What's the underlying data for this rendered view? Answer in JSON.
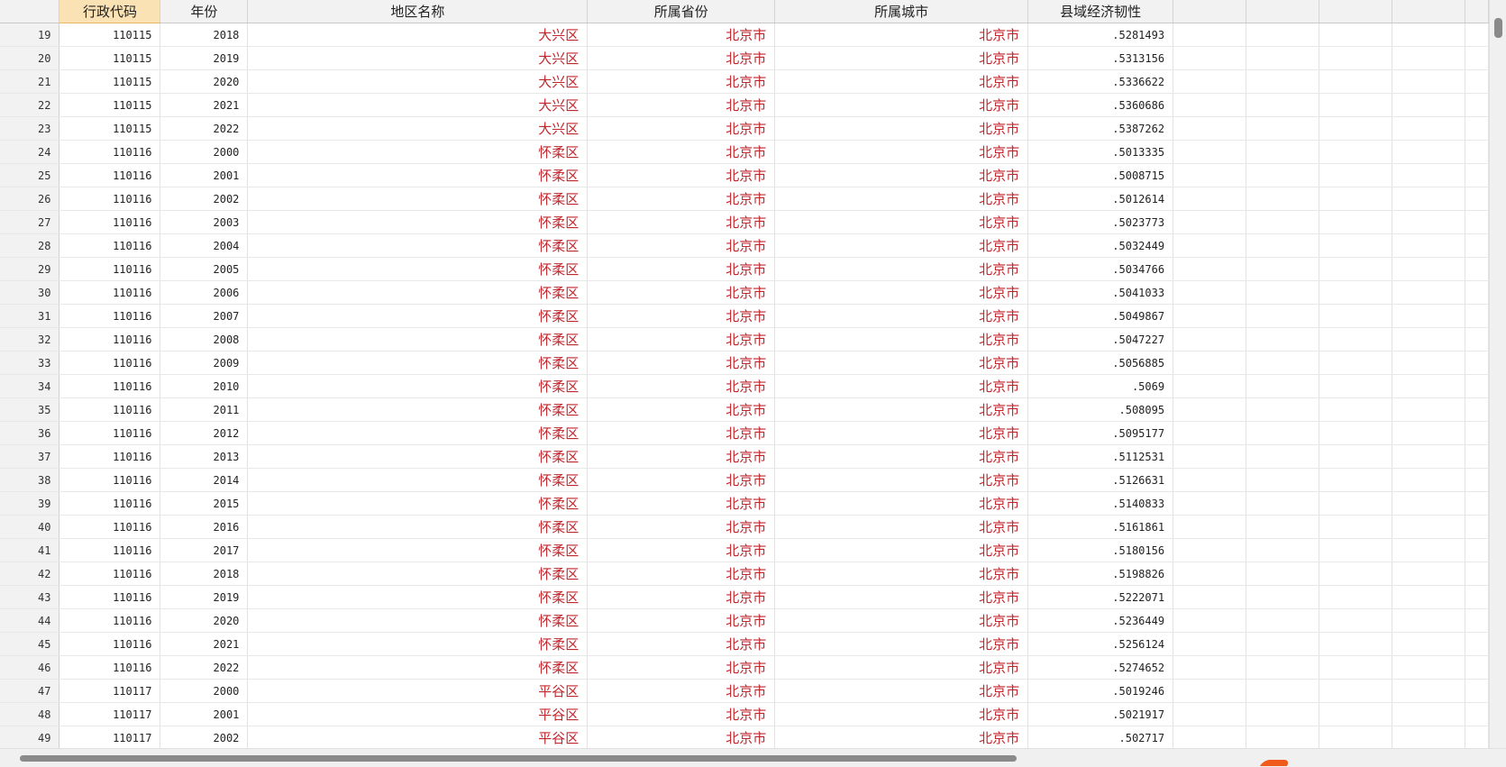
{
  "columns": [
    {
      "label": "行政代码",
      "selected": true
    },
    {
      "label": "年份",
      "selected": false
    },
    {
      "label": "地区名称",
      "selected": false
    },
    {
      "label": "所属省份",
      "selected": false
    },
    {
      "label": "所属城市",
      "selected": false
    },
    {
      "label": "县域经济韧性",
      "selected": false
    }
  ],
  "rows": [
    {
      "n": "19",
      "code": "110115",
      "year": "2018",
      "region": "大兴区",
      "province": "北京市",
      "city": "北京市",
      "value": ".5281493"
    },
    {
      "n": "20",
      "code": "110115",
      "year": "2019",
      "region": "大兴区",
      "province": "北京市",
      "city": "北京市",
      "value": ".5313156"
    },
    {
      "n": "21",
      "code": "110115",
      "year": "2020",
      "region": "大兴区",
      "province": "北京市",
      "city": "北京市",
      "value": ".5336622"
    },
    {
      "n": "22",
      "code": "110115",
      "year": "2021",
      "region": "大兴区",
      "province": "北京市",
      "city": "北京市",
      "value": ".5360686"
    },
    {
      "n": "23",
      "code": "110115",
      "year": "2022",
      "region": "大兴区",
      "province": "北京市",
      "city": "北京市",
      "value": ".5387262"
    },
    {
      "n": "24",
      "code": "110116",
      "year": "2000",
      "region": "怀柔区",
      "province": "北京市",
      "city": "北京市",
      "value": ".5013335"
    },
    {
      "n": "25",
      "code": "110116",
      "year": "2001",
      "region": "怀柔区",
      "province": "北京市",
      "city": "北京市",
      "value": ".5008715"
    },
    {
      "n": "26",
      "code": "110116",
      "year": "2002",
      "region": "怀柔区",
      "province": "北京市",
      "city": "北京市",
      "value": ".5012614"
    },
    {
      "n": "27",
      "code": "110116",
      "year": "2003",
      "region": "怀柔区",
      "province": "北京市",
      "city": "北京市",
      "value": ".5023773"
    },
    {
      "n": "28",
      "code": "110116",
      "year": "2004",
      "region": "怀柔区",
      "province": "北京市",
      "city": "北京市",
      "value": ".5032449"
    },
    {
      "n": "29",
      "code": "110116",
      "year": "2005",
      "region": "怀柔区",
      "province": "北京市",
      "city": "北京市",
      "value": ".5034766"
    },
    {
      "n": "30",
      "code": "110116",
      "year": "2006",
      "region": "怀柔区",
      "province": "北京市",
      "city": "北京市",
      "value": ".5041033"
    },
    {
      "n": "31",
      "code": "110116",
      "year": "2007",
      "region": "怀柔区",
      "province": "北京市",
      "city": "北京市",
      "value": ".5049867"
    },
    {
      "n": "32",
      "code": "110116",
      "year": "2008",
      "region": "怀柔区",
      "province": "北京市",
      "city": "北京市",
      "value": ".5047227"
    },
    {
      "n": "33",
      "code": "110116",
      "year": "2009",
      "region": "怀柔区",
      "province": "北京市",
      "city": "北京市",
      "value": ".5056885"
    },
    {
      "n": "34",
      "code": "110116",
      "year": "2010",
      "region": "怀柔区",
      "province": "北京市",
      "city": "北京市",
      "value": ".5069"
    },
    {
      "n": "35",
      "code": "110116",
      "year": "2011",
      "region": "怀柔区",
      "province": "北京市",
      "city": "北京市",
      "value": ".508095"
    },
    {
      "n": "36",
      "code": "110116",
      "year": "2012",
      "region": "怀柔区",
      "province": "北京市",
      "city": "北京市",
      "value": ".5095177"
    },
    {
      "n": "37",
      "code": "110116",
      "year": "2013",
      "region": "怀柔区",
      "province": "北京市",
      "city": "北京市",
      "value": ".5112531"
    },
    {
      "n": "38",
      "code": "110116",
      "year": "2014",
      "region": "怀柔区",
      "province": "北京市",
      "city": "北京市",
      "value": ".5126631"
    },
    {
      "n": "39",
      "code": "110116",
      "year": "2015",
      "region": "怀柔区",
      "province": "北京市",
      "city": "北京市",
      "value": ".5140833"
    },
    {
      "n": "40",
      "code": "110116",
      "year": "2016",
      "region": "怀柔区",
      "province": "北京市",
      "city": "北京市",
      "value": ".5161861"
    },
    {
      "n": "41",
      "code": "110116",
      "year": "2017",
      "region": "怀柔区",
      "province": "北京市",
      "city": "北京市",
      "value": ".5180156"
    },
    {
      "n": "42",
      "code": "110116",
      "year": "2018",
      "region": "怀柔区",
      "province": "北京市",
      "city": "北京市",
      "value": ".5198826"
    },
    {
      "n": "43",
      "code": "110116",
      "year": "2019",
      "region": "怀柔区",
      "province": "北京市",
      "city": "北京市",
      "value": ".5222071"
    },
    {
      "n": "44",
      "code": "110116",
      "year": "2020",
      "region": "怀柔区",
      "province": "北京市",
      "city": "北京市",
      "value": ".5236449"
    },
    {
      "n": "45",
      "code": "110116",
      "year": "2021",
      "region": "怀柔区",
      "province": "北京市",
      "city": "北京市",
      "value": ".5256124"
    },
    {
      "n": "46",
      "code": "110116",
      "year": "2022",
      "region": "怀柔区",
      "province": "北京市",
      "city": "北京市",
      "value": ".5274652"
    },
    {
      "n": "47",
      "code": "110117",
      "year": "2000",
      "region": "平谷区",
      "province": "北京市",
      "city": "北京市",
      "value": ".5019246"
    },
    {
      "n": "48",
      "code": "110117",
      "year": "2001",
      "region": "平谷区",
      "province": "北京市",
      "city": "北京市",
      "value": ".5021917"
    },
    {
      "n": "49",
      "code": "110117",
      "year": "2002",
      "region": "平谷区",
      "province": "北京市",
      "city": "北京市",
      "value": ".502717"
    }
  ],
  "colors": {
    "string_text": "#c0272d",
    "selected_header": "#fbe2b4",
    "scroll_thumb": "#8a8a8a"
  }
}
